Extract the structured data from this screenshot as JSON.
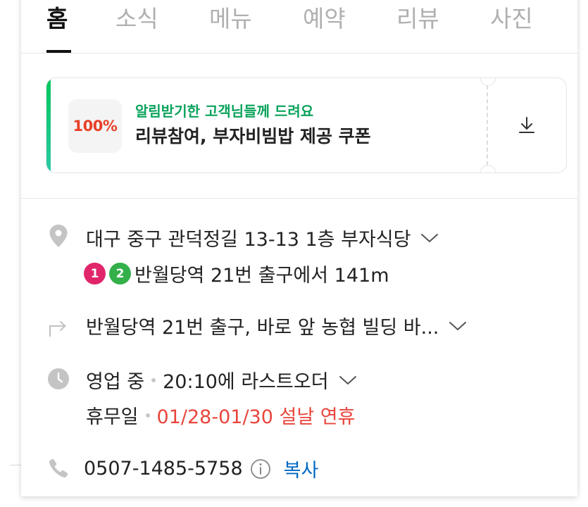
{
  "tabs": [
    {
      "label": "홈",
      "active": true
    },
    {
      "label": "소식",
      "active": false
    },
    {
      "label": "메뉴",
      "active": false
    },
    {
      "label": "예약",
      "active": false
    },
    {
      "label": "리뷰",
      "active": false
    },
    {
      "label": "사진",
      "active": false
    }
  ],
  "coupon": {
    "badge": "100%",
    "subtitle": "알림받기한 고객님들께 드려요",
    "title": "리뷰참여, 부자비빔밥 제공 쿠폰",
    "download_icon": "download-icon",
    "stripe_color": "#03c75a"
  },
  "info": {
    "address": "대구 중구 관덕정길 13-13 1층 부자식당",
    "subway": {
      "lines": [
        {
          "label": "1",
          "color": "#e0256b"
        },
        {
          "label": "2",
          "color": "#33b04a"
        }
      ],
      "text": "반월당역 21번 출구에서 141m"
    },
    "directions": "반월당역 21번 출구, 바로 앞 농협 빌딩 바...",
    "hours": {
      "status": "영업 중",
      "detail": "20:10에 라스트오더"
    },
    "holiday": {
      "label": "휴무일",
      "detail": "01/28-01/30 설날 연휴",
      "detail_color": "#e8453c"
    },
    "phone": {
      "number": "0507-1485-5758",
      "copy_label": "복사"
    }
  }
}
